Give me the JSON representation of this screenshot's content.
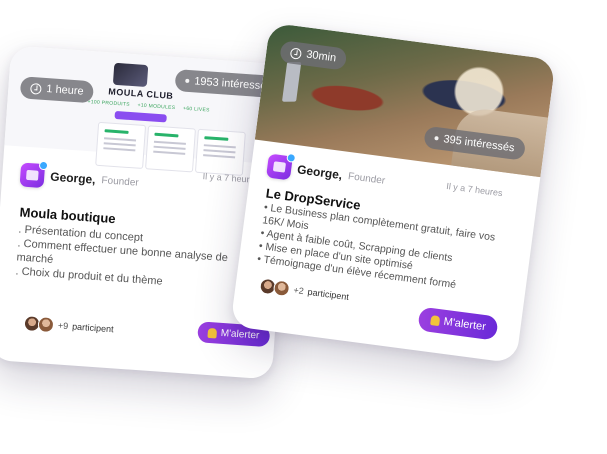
{
  "back_card": {
    "cover": {
      "logo_text": "MOULA CLUB",
      "tags": [
        "+100 PRODUITS",
        "+10 MODULES",
        "+60 LIVES"
      ]
    },
    "duration": "1 heure",
    "interested": "1953 intéressés",
    "author_name": "George,",
    "author_role": "Founder",
    "time_ago": "Il y a 7 heures",
    "title": "Moula boutique",
    "lines": [
      ". Présentation du concept",
      ". Comment effectuer une bonne analyse de marché",
      ". Choix du produit et du thème"
    ],
    "participants_count": "+9",
    "participants_label": "participent",
    "alert_label": "M'alerter"
  },
  "front_card": {
    "duration": "30min",
    "interested": "395 intéressés",
    "author_name": "George,",
    "author_role": "Founder",
    "time_ago": "Il y a 7 heures",
    "title": "Le DropService",
    "bullets": [
      "Le Business plan complètement gratuit, faire vos 16K/ Mois",
      "Agent à faible coût, Scrapping de clients",
      "Mise en place d'un site optimisé",
      "Témoignage d'un élève récemment formé"
    ],
    "participants_count": "+2",
    "participants_label": "participent",
    "alert_label": "M'alerter"
  },
  "colors": {
    "accent_purple": "#7b2ee0",
    "pill_gray": "#6e6e74",
    "verified_blue": "#39a8ff"
  }
}
